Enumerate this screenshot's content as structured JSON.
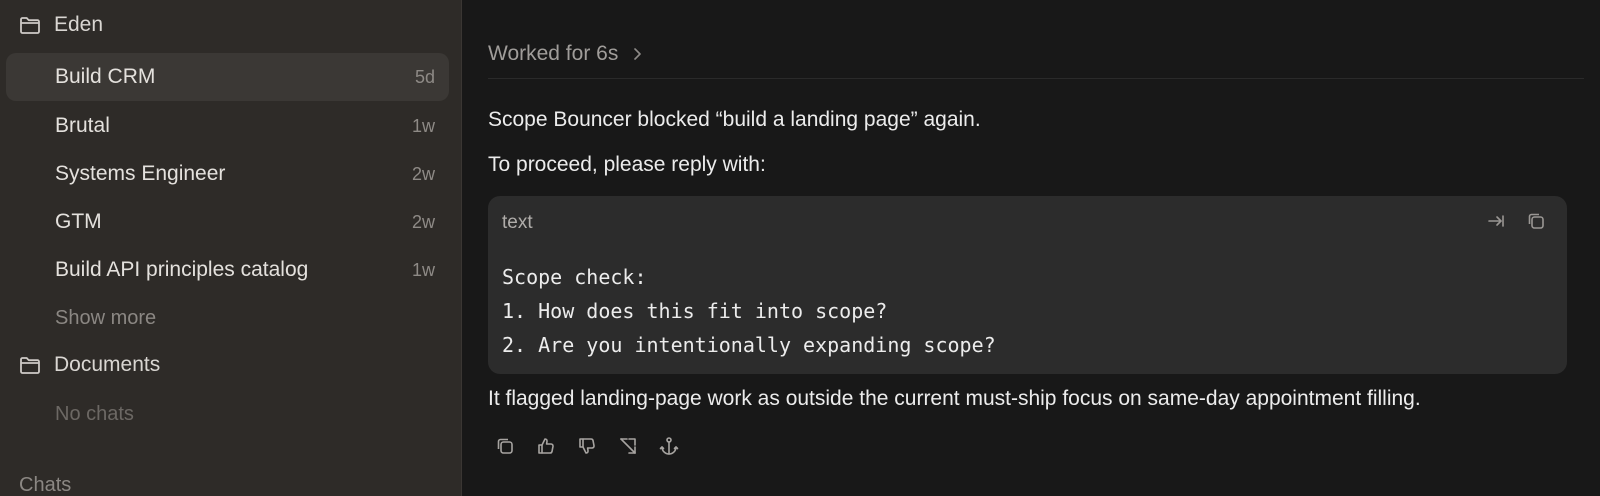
{
  "sidebar": {
    "folders": [
      {
        "name": "Eden",
        "icon": "folder-icon"
      },
      {
        "name": "Documents",
        "icon": "folder-icon"
      }
    ],
    "eden_items": [
      {
        "label": "Build CRM",
        "age": "5d",
        "active": true
      },
      {
        "label": "Brutal",
        "age": "1w"
      },
      {
        "label": "Systems Engineer",
        "age": "2w"
      },
      {
        "label": "GTM",
        "age": "2w"
      },
      {
        "label": "Build API principles catalog",
        "age": "1w"
      }
    ],
    "show_more": "Show more",
    "documents_empty": "No chats",
    "chats_section": "Chats"
  },
  "main": {
    "worked": "Worked for 6s",
    "line1": "Scope Bouncer blocked “build a landing page” again.",
    "line2": "To proceed, please reply with:",
    "code": {
      "lang": "text",
      "lines": [
        "Scope check:",
        "1. How does this fit into scope?",
        "2. Are you intentionally expanding scope?"
      ]
    },
    "line3": "It flagged landing-page work as outside the current must-ship focus on same-day appointment filling.",
    "actions": [
      "copy-icon",
      "thumbs-up-icon",
      "thumbs-down-icon",
      "fork-icon",
      "anchor-icon"
    ]
  },
  "colors": {
    "sidebar_bg": "#2e2b28",
    "main_bg": "#181818",
    "active_item_bg": "#3b3835",
    "code_bg": "#2c2c2c"
  }
}
